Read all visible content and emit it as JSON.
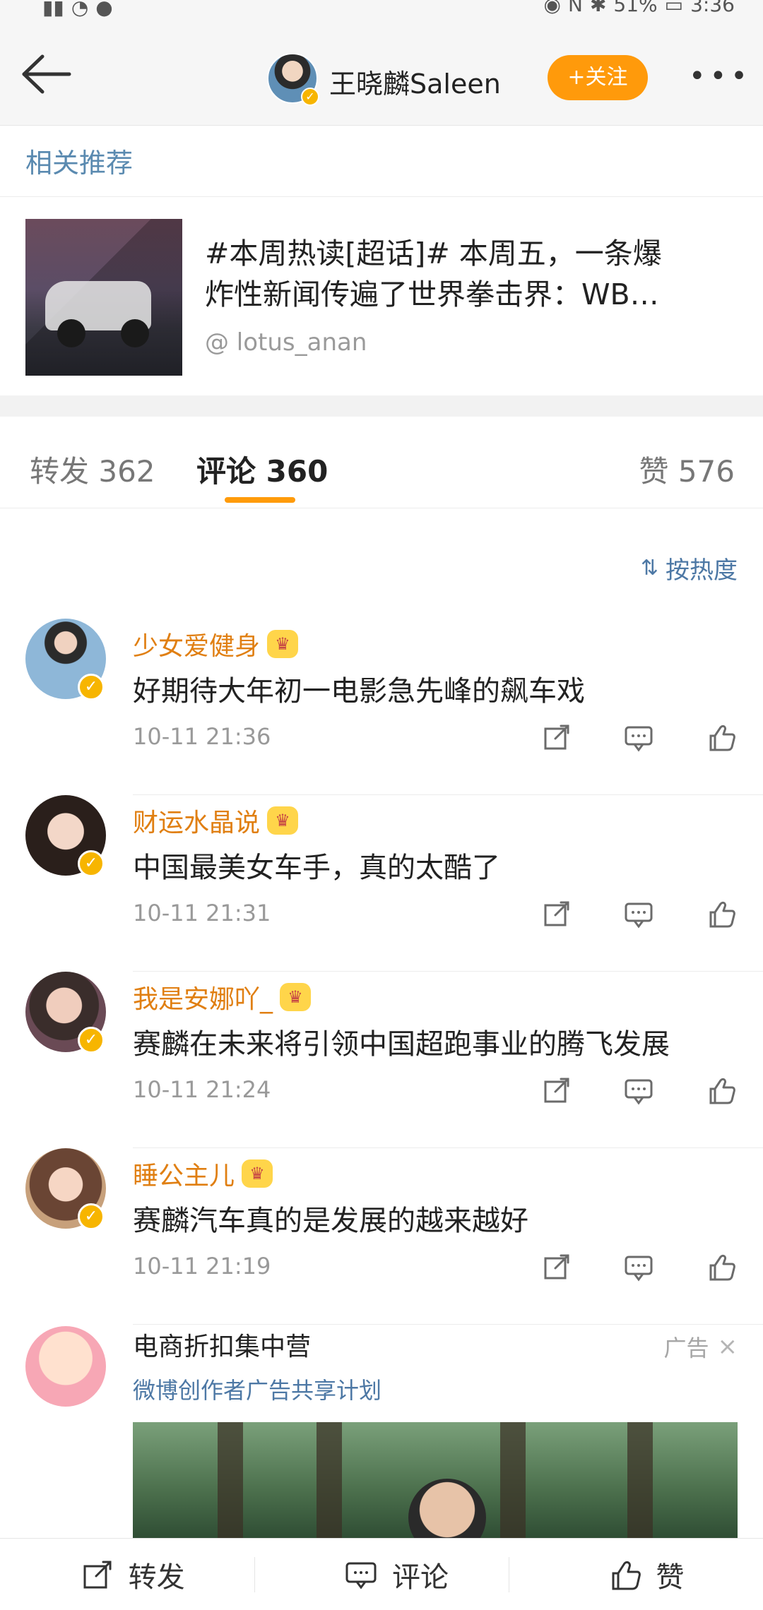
{
  "statusbar": {
    "battery": "51%",
    "time": "3:36"
  },
  "topnav": {
    "username": "王晓麟Saleen",
    "follow_label": "+关注",
    "more_label": "•••"
  },
  "related": {
    "title": "相关推荐",
    "post_line1": "#本周热读[超话]# 本周五，一条爆",
    "post_line2": "炸性新闻传遍了世界拳击界：WB…",
    "author": "@ lotus_anan"
  },
  "tabs": {
    "repost": "转发 362",
    "comment": "评论 360",
    "like": "赞 576"
  },
  "sort": {
    "label": "按热度"
  },
  "comments": [
    {
      "username": "少女爱健身",
      "text": "好期待大年初一电影急先峰的飙车戏",
      "time": "10-11 21:36"
    },
    {
      "username": "财运水晶说",
      "text": "中国最美女车手，真的太酷了",
      "time": "10-11 21:31"
    },
    {
      "username": "我是安娜吖_",
      "text": "赛麟在未来将引领中国超跑事业的腾飞发展",
      "time": "10-11 21:24"
    },
    {
      "username": "睡公主儿",
      "text": "赛麟汽车真的是发展的越来越好",
      "time": "10-11 21:19"
    }
  ],
  "ad": {
    "title": "电商折扣集中营",
    "subtitle": "微博创作者广告共享计划",
    "label": "广告",
    "close": "×"
  },
  "bottom": {
    "repost": "转发",
    "comment": "评论",
    "like": "赞"
  },
  "colors": {
    "accent_orange": "#ff9a0b",
    "username_orange": "#e07f12",
    "link_blue": "#4d78a5"
  }
}
